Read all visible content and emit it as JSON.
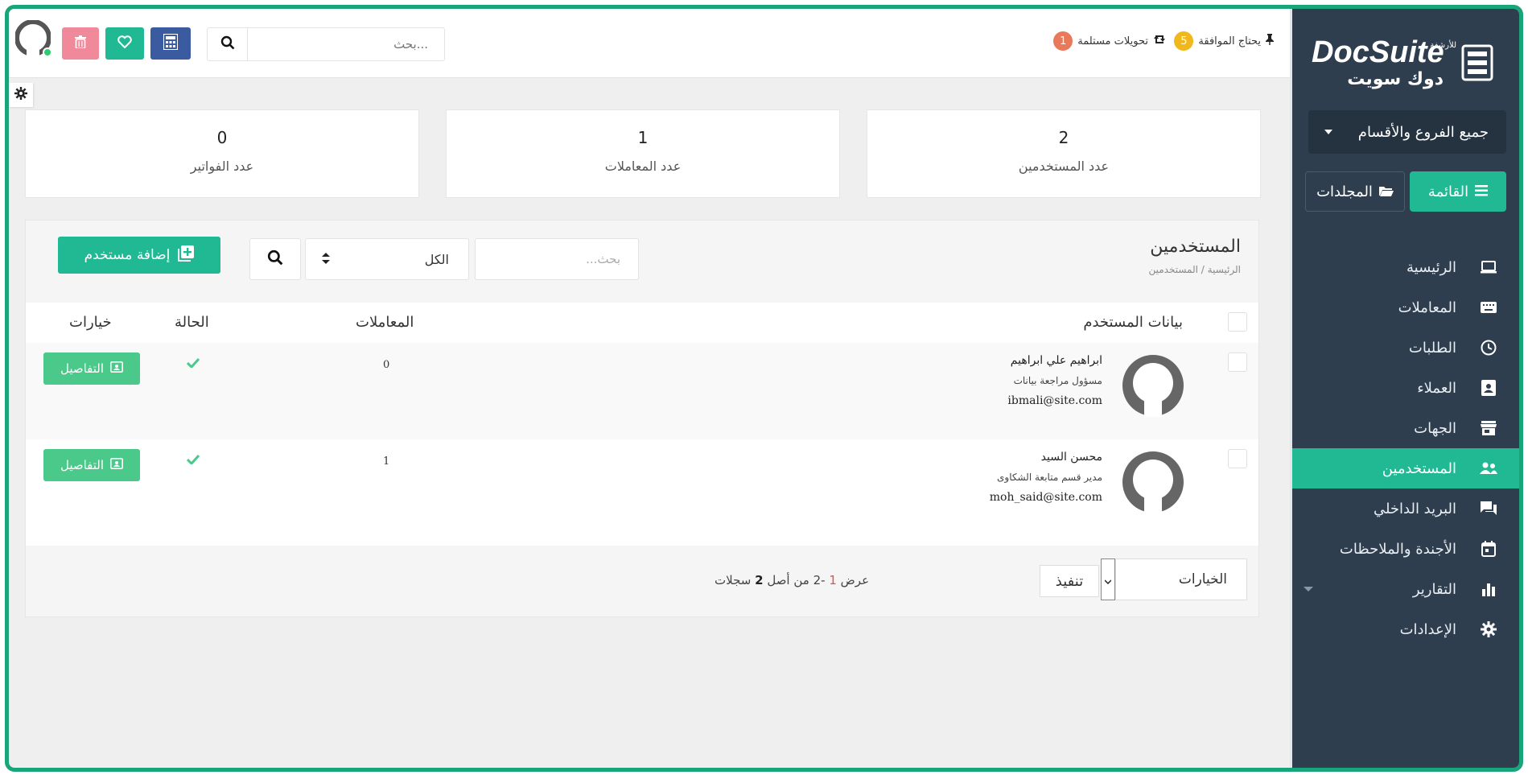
{
  "colors": {
    "sidebar": "#2e3e4e",
    "accent": "#20b993",
    "frame": "#1aa47a",
    "delete_btn": "#f08a9a",
    "heart_btn": "#20b993",
    "calc_btn": "#3a5ba0"
  },
  "brand": {
    "name_en": "DocSuite",
    "name_ar": "دوك سويت",
    "tag_ar": "للأرشفة"
  },
  "sidebar": {
    "branch_selector": "جميع الفروع والأقسام",
    "menu_button": "القائمة",
    "folders_button": "المجلدات",
    "items": [
      {
        "label": "الرئيسية",
        "icon": "laptop-icon"
      },
      {
        "label": "المعاملات",
        "icon": "keyboard-icon"
      },
      {
        "label": "الطلبات",
        "icon": "clock-icon"
      },
      {
        "label": "العملاء",
        "icon": "contact-card-icon"
      },
      {
        "label": "الجهات",
        "icon": "store-icon"
      },
      {
        "label": "المستخدمين",
        "icon": "users-icon",
        "active": true
      },
      {
        "label": "البريد الداخلي",
        "icon": "chat-icon"
      },
      {
        "label": "الأجندة والملاحظات",
        "icon": "calendar-icon"
      },
      {
        "label": "التقارير",
        "icon": "bar-chart-icon",
        "has_dropdown": true
      },
      {
        "label": "الإعدادات",
        "icon": "gear-icon"
      }
    ]
  },
  "topbar": {
    "search_placeholder": "بحث...",
    "notifications": [
      {
        "label": "يحتاج الموافقة",
        "count": "5",
        "icon": "pin-icon",
        "color": "#f0b81a"
      },
      {
        "label": "تحويلات مستلمة",
        "count": "1",
        "icon": "retweet-icon",
        "color": "#e8795a"
      }
    ]
  },
  "stats": [
    {
      "value": "2",
      "label": "عدد المستخدمين"
    },
    {
      "value": "1",
      "label": "عدد المعاملات"
    },
    {
      "value": "0",
      "label": "عدد الفواتير"
    }
  ],
  "users_panel": {
    "title": "المستخدمين",
    "breadcrumb": "الرئيسية / المستخدمين",
    "search_placeholder": "بحث...",
    "filter_value": "الكل",
    "add_button": "إضافة مستخدم",
    "columns": {
      "user": "بيانات المستخدم",
      "transactions": "المعاملات",
      "status": "الحالة",
      "options": "خيارات"
    },
    "rows": [
      {
        "name": "ابراهيم علي ابراهيم",
        "role": "مسؤول مراجعة بيانات",
        "email": "ibmali@site.com",
        "transactions": "0",
        "details": "التفاصيل"
      },
      {
        "name": "محسن السيد",
        "role": "مدير قسم متابعة الشكاوى",
        "email": "moh_said@site.com",
        "transactions": "1",
        "details": "التفاصيل"
      }
    ],
    "footer": {
      "options_label": "الخيارات",
      "execute_label": "تنفيذ",
      "page_prefix": "عرض",
      "page_from": "1",
      "page_range": "-2 من أصل",
      "page_total": "2",
      "page_suffix": "سجلات"
    }
  }
}
